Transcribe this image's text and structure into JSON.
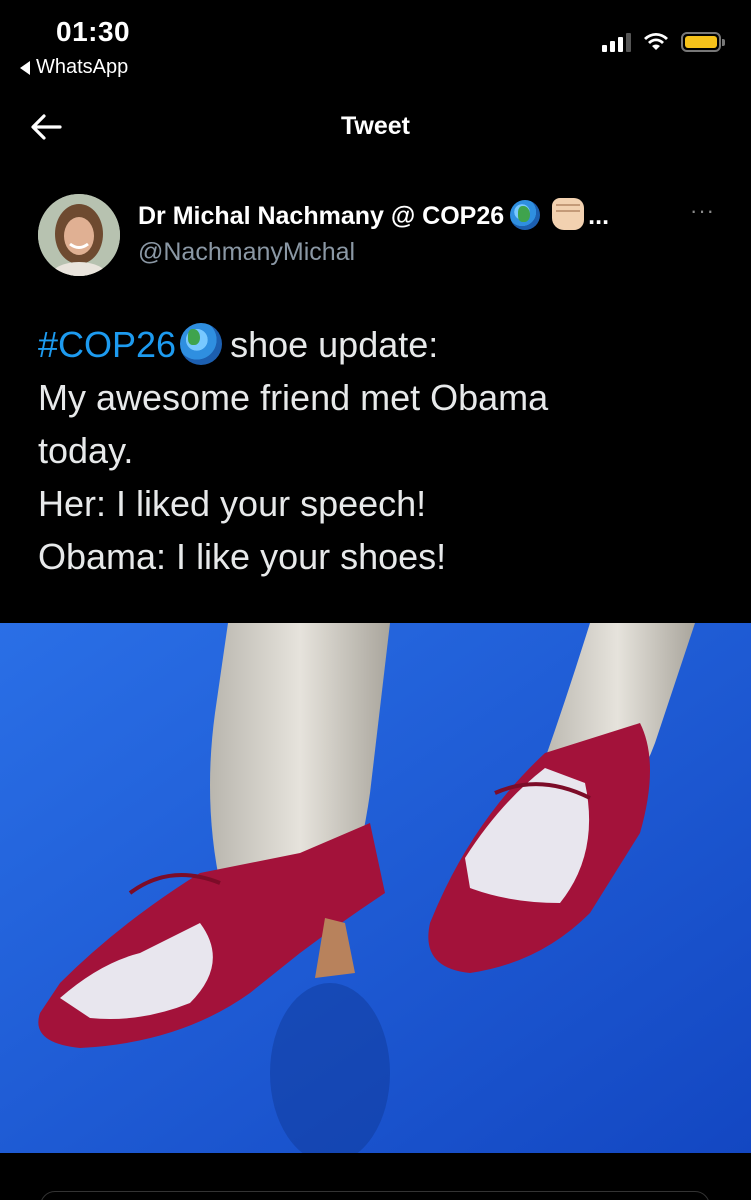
{
  "status_bar": {
    "time": "01:30",
    "back_app": "WhatsApp",
    "battery_color": "#f6c21a"
  },
  "header": {
    "title": "Tweet",
    "back_icon": "arrow-left-icon"
  },
  "author": {
    "name": "Dr Michal Nachmany @ COP26",
    "name_suffix": "...",
    "handle": "@NachmanyMichal",
    "more": "···"
  },
  "tweet": {
    "hashtag": "#COP26",
    "line1_rest": "shoe update:",
    "line2": "My awesome friend met Obama",
    "line3": "today.",
    "line4": "Her: I liked your speech!",
    "line5": "Obama: I like your shoes!"
  },
  "colors": {
    "link": "#1d9bf0",
    "background": "#000000",
    "handle": "#8b98a5",
    "carpet": "#1f5fd6",
    "shoe": "#a3123a"
  }
}
